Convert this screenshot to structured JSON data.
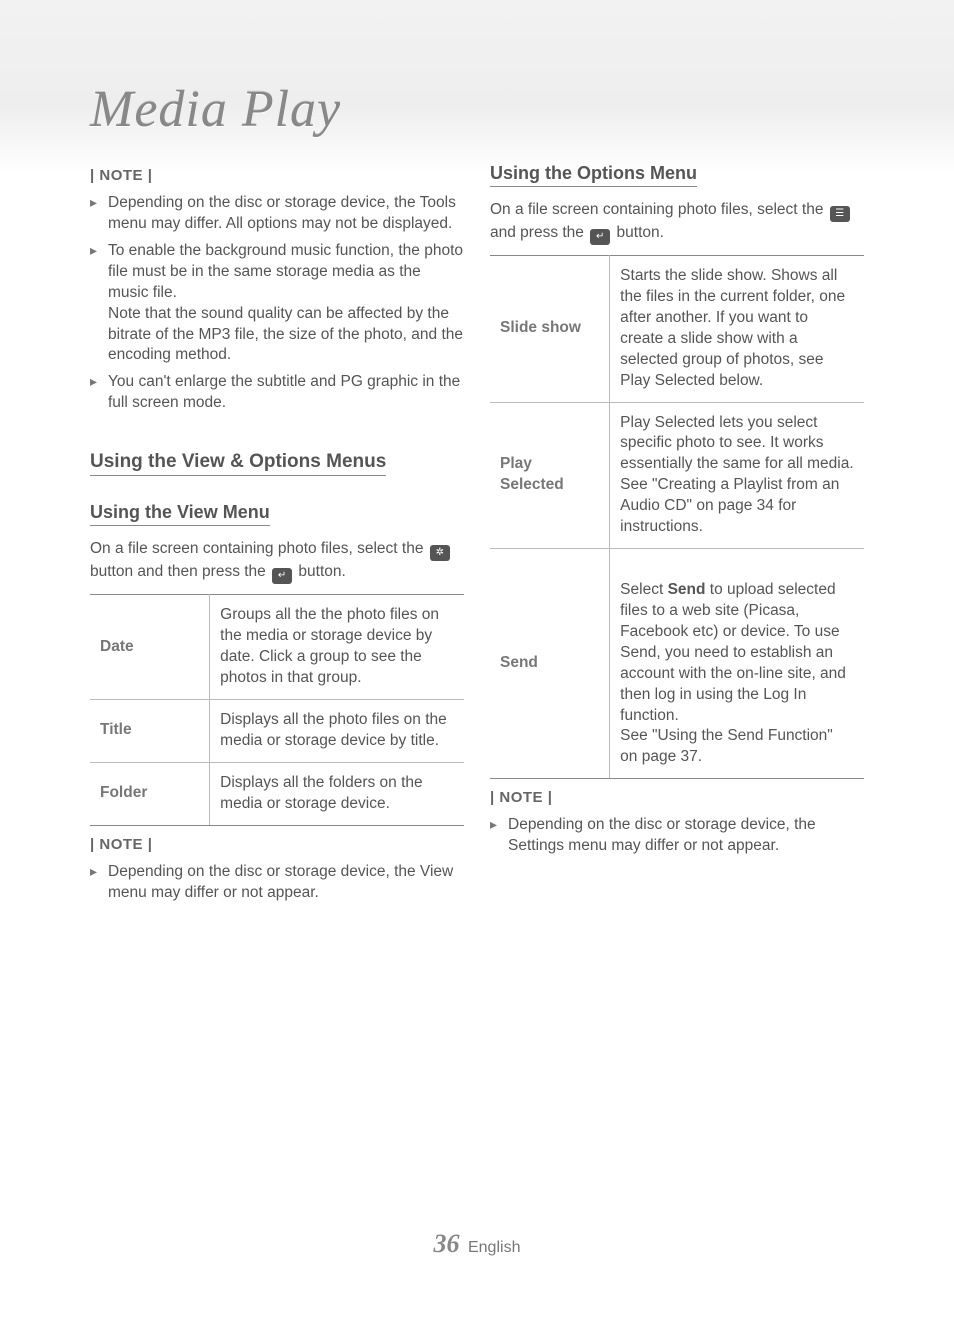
{
  "page": {
    "title": "Media Play",
    "number": "36",
    "language": "English"
  },
  "note_label": "| NOTE |",
  "left": {
    "notes_top": [
      "Depending on the disc or storage device, the Tools menu may differ. All options may not be displayed.",
      "To enable the background music function, the photo file must be in the same storage media as the music file.\nNote that the sound quality can be affected by the bitrate of the MP3 file, the size of the photo, and the encoding method.",
      "You can't enlarge the subtitle and PG graphic in the full screen mode."
    ],
    "section_heading": "Using the View & Options Menus",
    "view_heading": "Using the View Menu",
    "view_lead_a": "On a file screen containing photo files, select the ",
    "view_lead_b": " button and then press the ",
    "view_lead_c": " button.",
    "view_table": [
      {
        "name": "Date",
        "desc": "Groups all the the photo files on the media or storage device by date. Click a group to see the photos in that group."
      },
      {
        "name": "Title",
        "desc": "Displays all the photo files on the media or storage device by title."
      },
      {
        "name": "Folder",
        "desc": "Displays all the folders on the media or storage device."
      }
    ],
    "notes_bottom": [
      "Depending on the disc or storage device, the View menu may differ or not appear."
    ]
  },
  "right": {
    "options_heading": "Using the Options Menu",
    "options_lead_a": "On a file screen containing photo files, select the ",
    "options_lead_b": " and press the ",
    "options_lead_c": " button.",
    "options_table": [
      {
        "name": "Slide show",
        "desc": "Starts the slide show. Shows all the files in the current folder, one after another. If you want to create a slide show with a selected group of photos, see Play Selected below."
      },
      {
        "name": "Play Selected",
        "desc": "Play Selected lets you select specific photo to see. It works essentially the same for all media.\nSee \"Creating a Playlist from an Audio CD\" on page 34 for instructions."
      },
      {
        "name": "Send",
        "desc_a": "Select ",
        "desc_bold": "Send",
        "desc_b": " to upload selected files to a web site (Picasa, Facebook etc) or device. To use Send, you need to establish an account with the on-line site, and then log in using the Log In function.\nSee \"Using the Send Function\" on page 37."
      }
    ],
    "notes": [
      "Depending on the disc or storage device, the Settings menu may differ or not appear."
    ]
  }
}
